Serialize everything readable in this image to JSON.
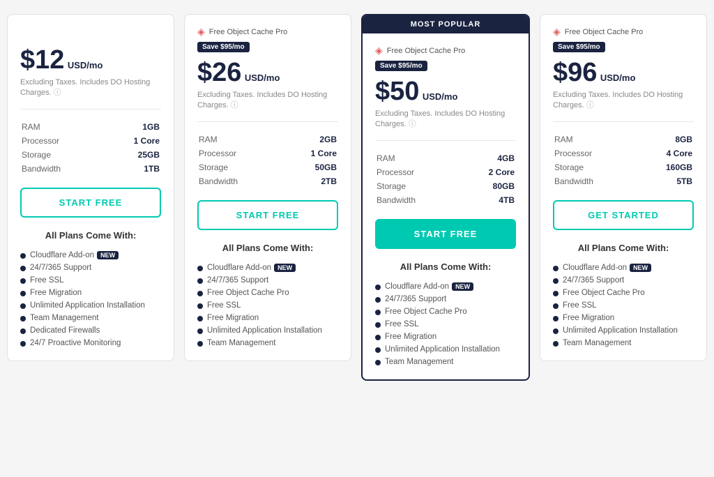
{
  "plans": [
    {
      "id": "plan-basic",
      "popular": false,
      "popular_label": "",
      "has_promo": false,
      "promo_text": "",
      "save_label": "",
      "price": "$12",
      "price_unit": "USD/mo",
      "price_note": "Excluding Taxes. Includes DO Hosting Charges.",
      "specs": [
        {
          "label": "RAM",
          "value": "1GB"
        },
        {
          "label": "Processor",
          "value": "1 Core"
        },
        {
          "label": "Storage",
          "value": "25GB"
        },
        {
          "label": "Bandwidth",
          "value": "1TB"
        }
      ],
      "btn_label": "START FREE",
      "btn_filled": false,
      "features_title": "All Plans Come With:",
      "features": [
        {
          "text": "Cloudflare Add-on",
          "new": true
        },
        {
          "text": "24/7/365 Support",
          "new": false
        },
        {
          "text": "Free SSL",
          "new": false
        },
        {
          "text": "Free Migration",
          "new": false
        },
        {
          "text": "Unlimited Application Installation",
          "new": false
        },
        {
          "text": "Team Management",
          "new": false
        },
        {
          "text": "Dedicated Firewalls",
          "new": false
        },
        {
          "text": "24/7 Proactive Monitoring",
          "new": false
        }
      ]
    },
    {
      "id": "plan-standard",
      "popular": false,
      "popular_label": "",
      "has_promo": true,
      "promo_text": "Free Object Cache Pro",
      "save_label": "Save $95/mo",
      "price": "$26",
      "price_unit": "USD/mo",
      "price_note": "Excluding Taxes. Includes DO Hosting Charges.",
      "specs": [
        {
          "label": "RAM",
          "value": "2GB"
        },
        {
          "label": "Processor",
          "value": "1 Core"
        },
        {
          "label": "Storage",
          "value": "50GB"
        },
        {
          "label": "Bandwidth",
          "value": "2TB"
        }
      ],
      "btn_label": "START FREE",
      "btn_filled": false,
      "features_title": "All Plans Come With:",
      "features": [
        {
          "text": "Cloudflare Add-on",
          "new": true
        },
        {
          "text": "24/7/365 Support",
          "new": false
        },
        {
          "text": "Free Object Cache Pro",
          "new": false
        },
        {
          "text": "Free SSL",
          "new": false
        },
        {
          "text": "Free Migration",
          "new": false
        },
        {
          "text": "Unlimited Application Installation",
          "new": false
        },
        {
          "text": "Team Management",
          "new": false
        }
      ]
    },
    {
      "id": "plan-popular",
      "popular": true,
      "popular_label": "MOST POPULAR",
      "has_promo": true,
      "promo_text": "Free Object Cache Pro",
      "save_label": "Save $95/mo",
      "price": "$50",
      "price_unit": "USD/mo",
      "price_note": "Excluding Taxes. Includes DO Hosting Charges.",
      "specs": [
        {
          "label": "RAM",
          "value": "4GB"
        },
        {
          "label": "Processor",
          "value": "2 Core"
        },
        {
          "label": "Storage",
          "value": "80GB"
        },
        {
          "label": "Bandwidth",
          "value": "4TB"
        }
      ],
      "btn_label": "START FREE",
      "btn_filled": true,
      "features_title": "All Plans Come With:",
      "features": [
        {
          "text": "Cloudflare Add-on",
          "new": true
        },
        {
          "text": "24/7/365 Support",
          "new": false
        },
        {
          "text": "Free Object Cache Pro",
          "new": false
        },
        {
          "text": "Free SSL",
          "new": false
        },
        {
          "text": "Free Migration",
          "new": false
        },
        {
          "text": "Unlimited Application Installation",
          "new": false
        },
        {
          "text": "Team Management",
          "new": false
        }
      ]
    },
    {
      "id": "plan-pro",
      "popular": false,
      "popular_label": "",
      "has_promo": true,
      "promo_text": "Free Object Cache Pro",
      "save_label": "Save $95/mo",
      "price": "$96",
      "price_unit": "USD/mo",
      "price_note": "Excluding Taxes. Includes DO Hosting Charges.",
      "specs": [
        {
          "label": "RAM",
          "value": "8GB"
        },
        {
          "label": "Processor",
          "value": "4 Core"
        },
        {
          "label": "Storage",
          "value": "160GB"
        },
        {
          "label": "Bandwidth",
          "value": "5TB"
        }
      ],
      "btn_label": "GET STARTED",
      "btn_filled": false,
      "features_title": "All Plans Come With:",
      "features": [
        {
          "text": "Cloudflare Add-on",
          "new": true
        },
        {
          "text": "24/7/365 Support",
          "new": false
        },
        {
          "text": "Free Object Cache Pro",
          "new": false
        },
        {
          "text": "Free SSL",
          "new": false
        },
        {
          "text": "Free Migration",
          "new": false
        },
        {
          "text": "Unlimited Application Installation",
          "new": false
        },
        {
          "text": "Team Management",
          "new": false
        }
      ]
    }
  ]
}
